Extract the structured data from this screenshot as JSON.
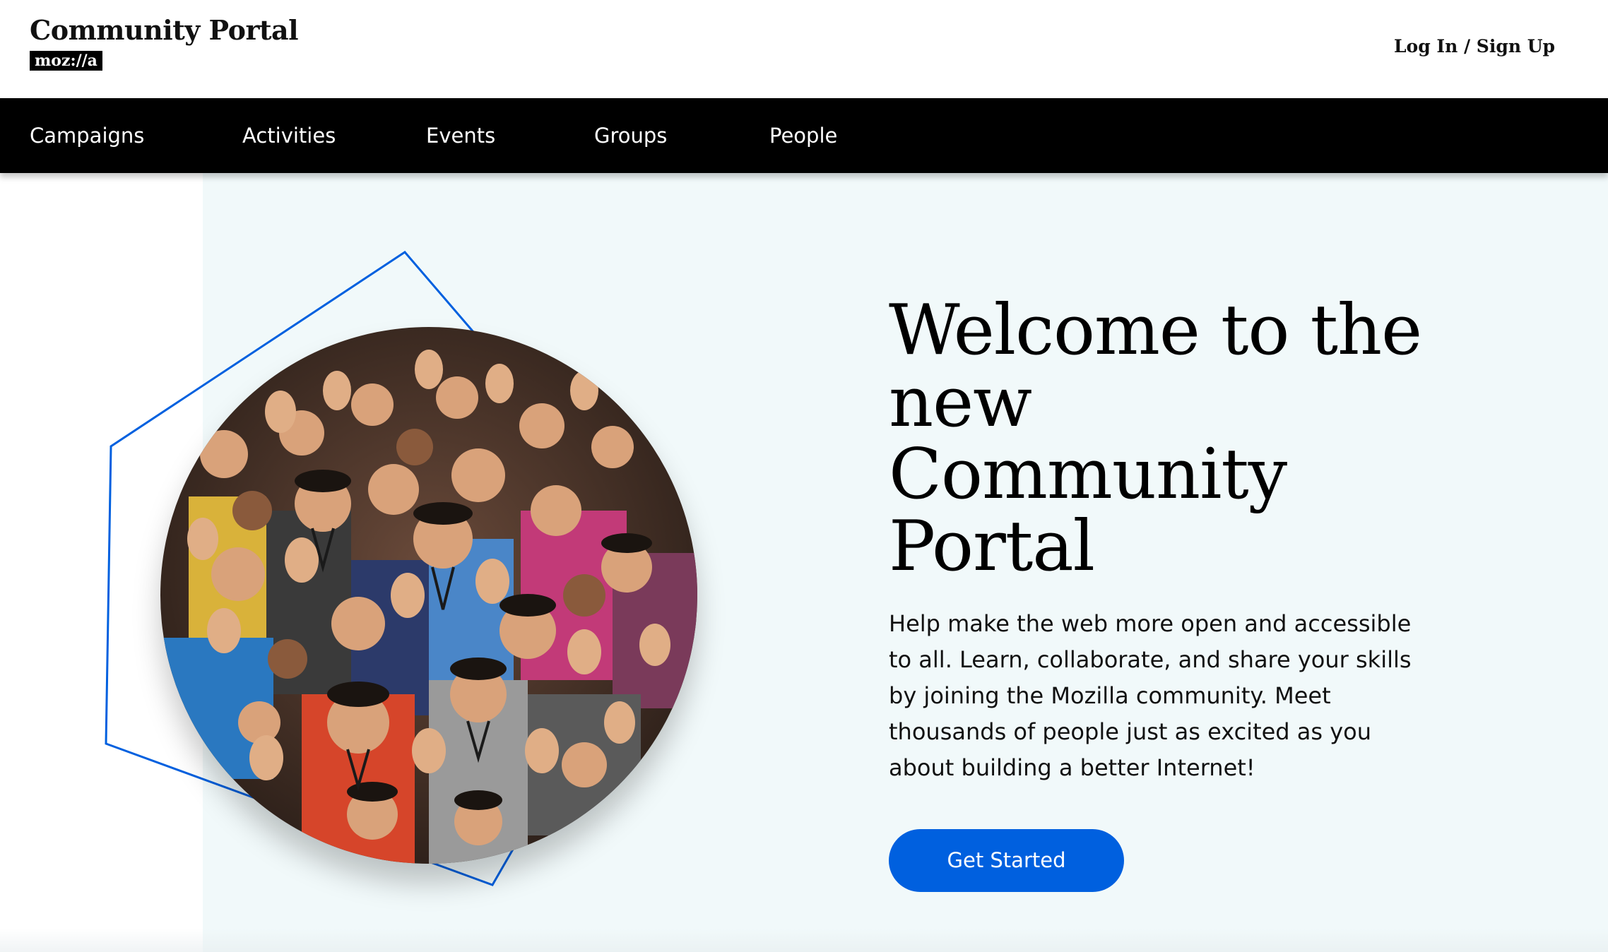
{
  "header": {
    "site_title": "Community Portal",
    "logo_text": "moz://a",
    "auth_link": "Log In / Sign Up"
  },
  "nav": {
    "items": [
      {
        "label": "Campaigns"
      },
      {
        "label": "Activities"
      },
      {
        "label": "Events"
      },
      {
        "label": "Groups"
      },
      {
        "label": "People"
      }
    ]
  },
  "hero": {
    "title": "Welcome to the new Community Portal",
    "description": "Help make the web more open and accessible to all. Learn, collaborate, and share your skills by joining the Mozilla community. Meet thousands of people just as excited as you about building a better Internet!",
    "cta_label": "Get Started",
    "image_subject": "crowd-of-people-waving-photo"
  },
  "colors": {
    "nav_background": "#000000",
    "hero_background": "#f1f9fa",
    "accent_blue": "#0060df",
    "hexagon_stroke": "#0060df"
  }
}
